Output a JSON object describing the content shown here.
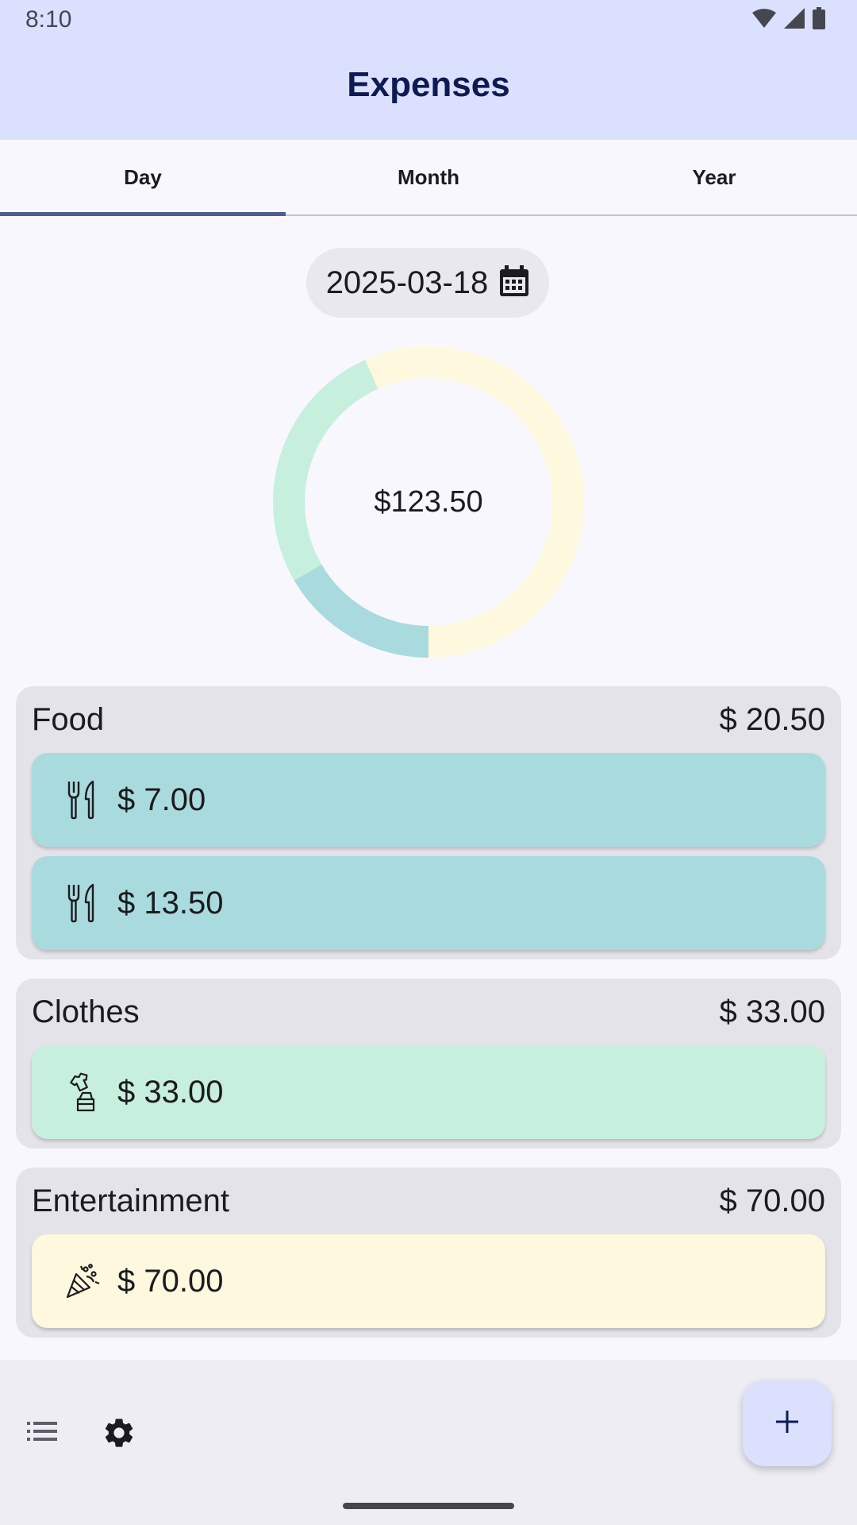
{
  "status_bar": {
    "time": "8:10",
    "icons": [
      "wifi-icon",
      "cell-signal-icon",
      "battery-icon"
    ]
  },
  "app_bar": {
    "title": "Expenses"
  },
  "tabs": [
    {
      "label": "Day",
      "selected": true
    },
    {
      "label": "Month",
      "selected": false
    },
    {
      "label": "Year",
      "selected": false
    }
  ],
  "date_picker": {
    "value": "2025-03-18",
    "icon": "calendar-icon"
  },
  "chart_data": {
    "type": "pie",
    "variant": "donut",
    "center_label": "$123.50",
    "slices": [
      {
        "category": "Food",
        "value": 20.5,
        "color": "#a9dbde"
      },
      {
        "category": "Clothes",
        "value": 33.0,
        "color": "#c7efdd"
      },
      {
        "category": "Entertainment",
        "value": 70.0,
        "color": "#fdf8de"
      }
    ]
  },
  "categories": [
    {
      "name": "Food",
      "total": "$ 20.50",
      "color": "#a9dbde",
      "icon": "fork-knife-icon",
      "items": [
        {
          "amount": "$ 7.00"
        },
        {
          "amount": "$ 13.50"
        }
      ]
    },
    {
      "name": "Clothes",
      "total": "$ 33.00",
      "color": "#c7efdd",
      "icon": "clothes-icon",
      "items": [
        {
          "amount": "$ 33.00"
        }
      ]
    },
    {
      "name": "Entertainment",
      "total": "$ 70.00",
      "color": "#fdf8de",
      "icon": "party-popper-icon",
      "items": [
        {
          "amount": "$ 70.00"
        }
      ]
    }
  ],
  "bottom_bar": {
    "icons": [
      "list-icon",
      "settings-gear-icon"
    ],
    "fab_icon": "add-icon"
  },
  "colors": {
    "app_bar_bg": "#dbe0ff",
    "tab_indicator": "#4f5b92",
    "card_bg": "#e4e3e9"
  }
}
